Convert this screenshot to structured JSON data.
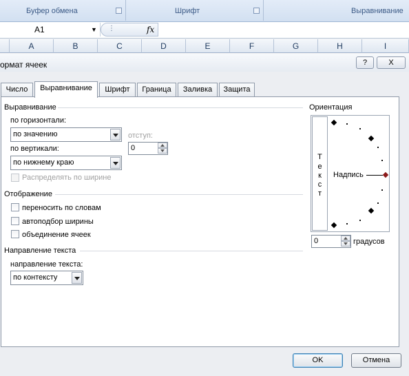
{
  "ribbon": {
    "group_clipboard": "Буфер обмена",
    "group_font": "Шрифт",
    "group_alignment": "Выравнивание"
  },
  "formula_bar": {
    "name_box": "A1",
    "fx": "fx"
  },
  "columns": [
    "A",
    "B",
    "C",
    "D",
    "E",
    "F",
    "G",
    "H",
    "I"
  ],
  "dialog": {
    "title": "ормат ячеек",
    "help": "?",
    "close": "X",
    "tabs": [
      "Число",
      "Выравнивание",
      "Шрифт",
      "Граница",
      "Заливка",
      "Защита"
    ],
    "active_tab": "Выравнивание",
    "alignment": {
      "section": "Выравнивание",
      "horizontal_label": "по горизонтали:",
      "horizontal_value": "по значению",
      "indent_label": "отступ:",
      "indent_value": "0",
      "vertical_label": "по вертикали:",
      "vertical_value": "по нижнему краю",
      "distribute_label": "Распределять по ширине"
    },
    "display": {
      "section": "Отображение",
      "wrap": "переносить по словам",
      "shrink": "автоподбор ширины",
      "merge": "объединение ячеек"
    },
    "direction": {
      "section": "Направление текста",
      "label": "направление текста:",
      "value": "по контексту"
    },
    "orientation": {
      "section": "Ориентация",
      "vertical_letters": [
        "Т",
        "е",
        "к",
        "с",
        "т"
      ],
      "label": "Надпись",
      "degrees_value": "0",
      "degrees_label": "градусов"
    },
    "ok": "OK",
    "cancel": "Отмена"
  }
}
